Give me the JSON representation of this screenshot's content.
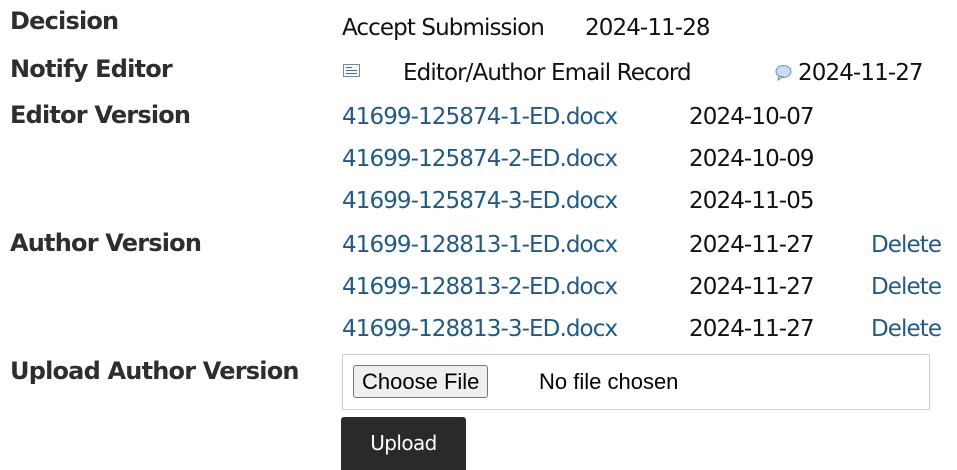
{
  "decision": {
    "label": "Decision",
    "value": "Accept Submission",
    "date": "2024-11-28"
  },
  "notify_editor": {
    "label": "Notify Editor",
    "icon": "email-record-icon",
    "link": "Editor/Author Email Record",
    "comment_icon": "comment-bubble-icon",
    "date": "2024-11-27"
  },
  "editor_version": {
    "label": "Editor Version",
    "files": [
      {
        "name": "41699-125874-1-ED.docx",
        "date": "2024-10-07"
      },
      {
        "name": "41699-125874-2-ED.docx",
        "date": "2024-10-09"
      },
      {
        "name": "41699-125874-3-ED.docx",
        "date": "2024-11-05"
      }
    ]
  },
  "author_version": {
    "label": "Author Version",
    "files": [
      {
        "name": "41699-128813-1-ED.docx",
        "date": "2024-11-27",
        "action": "Delete"
      },
      {
        "name": "41699-128813-2-ED.docx",
        "date": "2024-11-27",
        "action": "Delete"
      },
      {
        "name": "41699-128813-3-ED.docx",
        "date": "2024-11-27",
        "action": "Delete"
      }
    ]
  },
  "upload_author_version": {
    "label": "Upload Author Version",
    "choose_file_label": "Choose File",
    "no_file_text": "No file chosen",
    "upload_label": "Upload"
  },
  "colors": {
    "link": "#1f5a8a",
    "upload_button_bg": "#2a2a2a"
  }
}
